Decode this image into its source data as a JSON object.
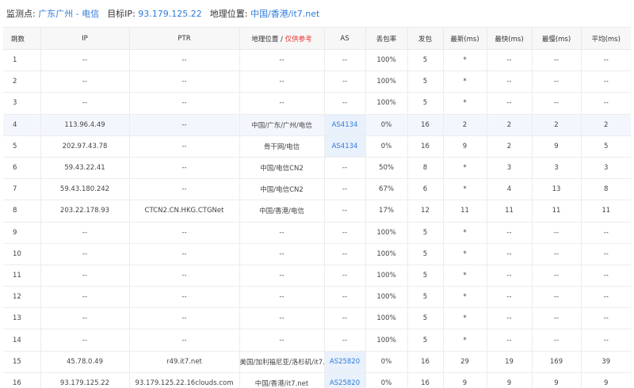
{
  "header": {
    "monitor_label": "监测点:",
    "monitor_value": "广东广州 - 电信",
    "target_label": "目标IP:",
    "target_value": "93.179.125.22",
    "geo_label": "地理位置:",
    "geo_value": "中国/香港/it7.net"
  },
  "columns": {
    "hop": "跳数",
    "ip": "IP",
    "ptr": "PTR",
    "geo": "地理位置",
    "geo_sep": " / ",
    "geo_note": "仅供参考",
    "as": "AS",
    "loss": "丢包率",
    "sent": "发包",
    "last": "最新(ms)",
    "best": "最快(ms)",
    "worst": "最慢(ms)",
    "avg": "平均(ms)"
  },
  "rows": [
    {
      "hop": "1",
      "ip": "--",
      "ptr": "--",
      "geo": "--",
      "as": "--",
      "loss": "100%",
      "sent": "5",
      "last": "*",
      "best": "--",
      "worst": "--",
      "avg": "--"
    },
    {
      "hop": "2",
      "ip": "--",
      "ptr": "--",
      "geo": "--",
      "as": "--",
      "loss": "100%",
      "sent": "5",
      "last": "*",
      "best": "--",
      "worst": "--",
      "avg": "--"
    },
    {
      "hop": "3",
      "ip": "--",
      "ptr": "--",
      "geo": "--",
      "as": "--",
      "loss": "100%",
      "sent": "5",
      "last": "*",
      "best": "--",
      "worst": "--",
      "avg": "--"
    },
    {
      "hop": "4",
      "ip": "113.96.4.49",
      "ptr": "--",
      "geo": "中国/广东/广州/电信",
      "as": "AS4134",
      "loss": "0%",
      "sent": "16",
      "last": "2",
      "best": "2",
      "worst": "2",
      "avg": "2"
    },
    {
      "hop": "5",
      "ip": "202.97.43.78",
      "ptr": "--",
      "geo": "骨干网/电信",
      "as": "AS4134",
      "loss": "0%",
      "sent": "16",
      "last": "9",
      "best": "2",
      "worst": "9",
      "avg": "5"
    },
    {
      "hop": "6",
      "ip": "59.43.22.41",
      "ptr": "--",
      "geo": "中国/电信CN2",
      "as": "--",
      "loss": "50%",
      "sent": "8",
      "last": "*",
      "best": "3",
      "worst": "3",
      "avg": "3"
    },
    {
      "hop": "7",
      "ip": "59.43.180.242",
      "ptr": "--",
      "geo": "中国/电信CN2",
      "as": "--",
      "loss": "67%",
      "sent": "6",
      "last": "*",
      "best": "4",
      "worst": "13",
      "avg": "8"
    },
    {
      "hop": "8",
      "ip": "203.22.178.93",
      "ptr": "CTCN2.CN.HKG.CTGNet",
      "geo": "中国/香港/电信",
      "as": "--",
      "loss": "17%",
      "sent": "12",
      "last": "11",
      "best": "11",
      "worst": "11",
      "avg": "11"
    },
    {
      "hop": "9",
      "ip": "--",
      "ptr": "--",
      "geo": "--",
      "as": "--",
      "loss": "100%",
      "sent": "5",
      "last": "*",
      "best": "--",
      "worst": "--",
      "avg": "--"
    },
    {
      "hop": "10",
      "ip": "--",
      "ptr": "--",
      "geo": "--",
      "as": "--",
      "loss": "100%",
      "sent": "5",
      "last": "*",
      "best": "--",
      "worst": "--",
      "avg": "--"
    },
    {
      "hop": "11",
      "ip": "--",
      "ptr": "--",
      "geo": "--",
      "as": "--",
      "loss": "100%",
      "sent": "5",
      "last": "*",
      "best": "--",
      "worst": "--",
      "avg": "--"
    },
    {
      "hop": "12",
      "ip": "--",
      "ptr": "--",
      "geo": "--",
      "as": "--",
      "loss": "100%",
      "sent": "5",
      "last": "*",
      "best": "--",
      "worst": "--",
      "avg": "--"
    },
    {
      "hop": "13",
      "ip": "--",
      "ptr": "--",
      "geo": "--",
      "as": "--",
      "loss": "100%",
      "sent": "5",
      "last": "*",
      "best": "--",
      "worst": "--",
      "avg": "--"
    },
    {
      "hop": "14",
      "ip": "--",
      "ptr": "--",
      "geo": "--",
      "as": "--",
      "loss": "100%",
      "sent": "5",
      "last": "*",
      "best": "--",
      "worst": "--",
      "avg": "--"
    },
    {
      "hop": "15",
      "ip": "45.78.0.49",
      "ptr": "r49.it7.net",
      "geo": "美国/加利福尼亚/洛杉矶/it7.net",
      "as": "AS25820",
      "loss": "0%",
      "sent": "16",
      "last": "29",
      "best": "19",
      "worst": "169",
      "avg": "39"
    },
    {
      "hop": "16",
      "ip": "93.179.125.22",
      "ptr": "93.179.125.22.16clouds.com",
      "geo": "中国/香港/it7.net",
      "as": "AS25820",
      "loss": "0%",
      "sent": "16",
      "last": "9",
      "best": "9",
      "worst": "9",
      "avg": "9"
    }
  ],
  "highlight_row_index": 3,
  "colors": {
    "link": "#2f7bd9",
    "note": "#e8342e",
    "header_bg": "#f7f7f7",
    "highlight_bg": "#f3f7fd"
  }
}
